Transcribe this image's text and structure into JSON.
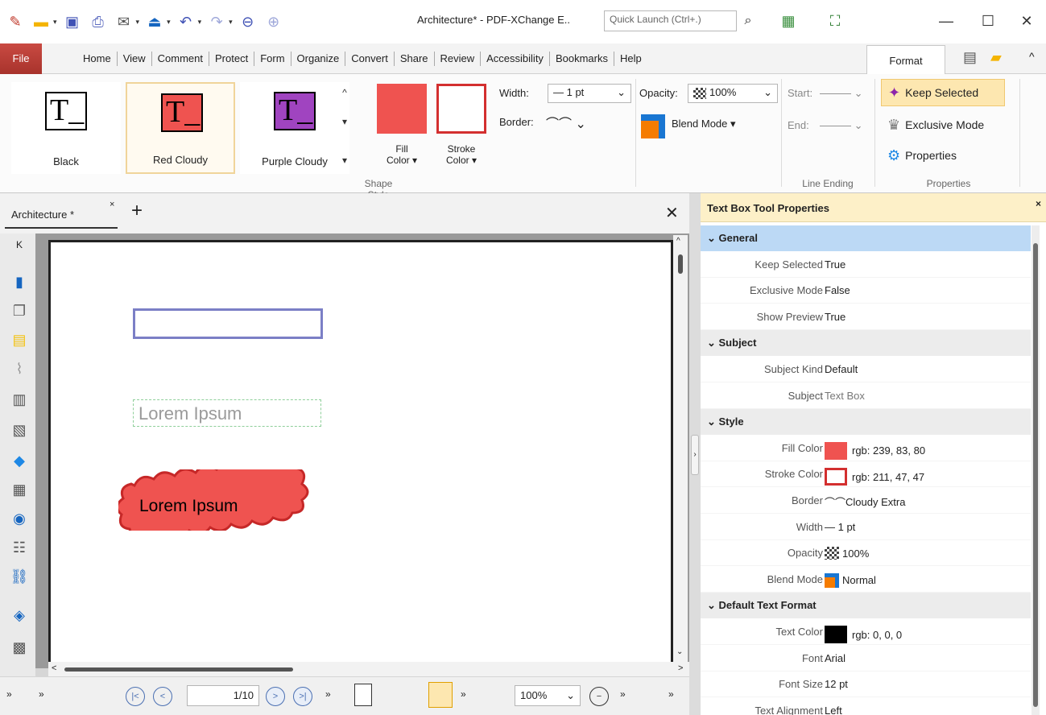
{
  "window": {
    "title": "Architecture* - PDF-XChange E..",
    "quick_launch_placeholder": "Quick Launch (Ctrl+.)",
    "minimize": "—",
    "maximize": "☐",
    "close": "✕"
  },
  "menu": {
    "file": "File",
    "items": [
      "Home",
      "View",
      "Comment",
      "Protect",
      "Form",
      "Organize",
      "Convert",
      "Share",
      "Review",
      "Accessibility",
      "Bookmarks",
      "Help"
    ],
    "active_tab": "Format"
  },
  "ribbon": {
    "styles": [
      {
        "label": "Black",
        "glyph": "T_",
        "fill": "#ffffff",
        "selected": false
      },
      {
        "label": "Red Cloudy",
        "glyph": "T_",
        "fill": "#ef5350",
        "selected": true
      },
      {
        "label": "Purple Cloudy",
        "glyph": "T_",
        "fill": "#a044c0",
        "selected": false
      }
    ],
    "fill_color_label": "Fill\nColor ▾",
    "stroke_color_label": "Stroke\nColor ▾",
    "fill_color": "#ef5350",
    "stroke_color": "#d32f2f",
    "width_label": "Width:",
    "width_value": "— 1 pt",
    "border_label": "Border:",
    "opacity_label": "Opacity:",
    "opacity_value": "100%",
    "blend_mode": "Blend Mode ▾",
    "start_label": "Start:",
    "end_label": "End:",
    "keep_selected": "Keep Selected",
    "exclusive_mode": "Exclusive Mode",
    "properties": "Properties",
    "group_shape_style": "Shape Style",
    "group_line_ending": "Line Ending",
    "group_properties": "Properties"
  },
  "tabs": {
    "doc_tab": "Architecture *",
    "close_x": "×",
    "new_tab": "+"
  },
  "page": {
    "text_dashed": "Lorem Ipsum",
    "text_cloudy": "Lorem Ipsum"
  },
  "bottombar": {
    "page_value": "1/10",
    "zoom_value": "100%"
  },
  "props": {
    "header": "Text Box Tool Properties",
    "sections": {
      "general": "General",
      "subject": "Subject",
      "style": "Style",
      "default_text_format": "Default Text Format"
    },
    "rows": {
      "keep_selected": {
        "label": "Keep Selected",
        "value": "True"
      },
      "exclusive_mode": {
        "label": "Exclusive Mode",
        "value": "False"
      },
      "show_preview": {
        "label": "Show Preview",
        "value": "True"
      },
      "subject_kind": {
        "label": "Subject Kind",
        "value": "Default"
      },
      "subject": {
        "label": "Subject",
        "value": "Text Box"
      },
      "fill_color": {
        "label": "Fill Color",
        "value": "rgb: 239, 83, 80",
        "swatch": "#ef5350"
      },
      "stroke_color": {
        "label": "Stroke Color",
        "value": "rgb: 211, 47, 47",
        "swatch": "#d32f2f"
      },
      "border": {
        "label": "Border",
        "value": "Cloudy Extra"
      },
      "width": {
        "label": "Width",
        "value": "— 1 pt"
      },
      "opacity": {
        "label": "Opacity",
        "value": "100%"
      },
      "blend_mode": {
        "label": "Blend Mode",
        "value": "Normal"
      },
      "text_color": {
        "label": "Text Color",
        "value": "rgb: 0, 0, 0",
        "swatch": "#000000"
      },
      "font": {
        "label": "Font",
        "value": "Arial"
      },
      "font_size": {
        "label": "Font Size",
        "value": "12 pt"
      },
      "text_alignment": {
        "label": "Text Alignment",
        "value": "Left"
      }
    }
  }
}
